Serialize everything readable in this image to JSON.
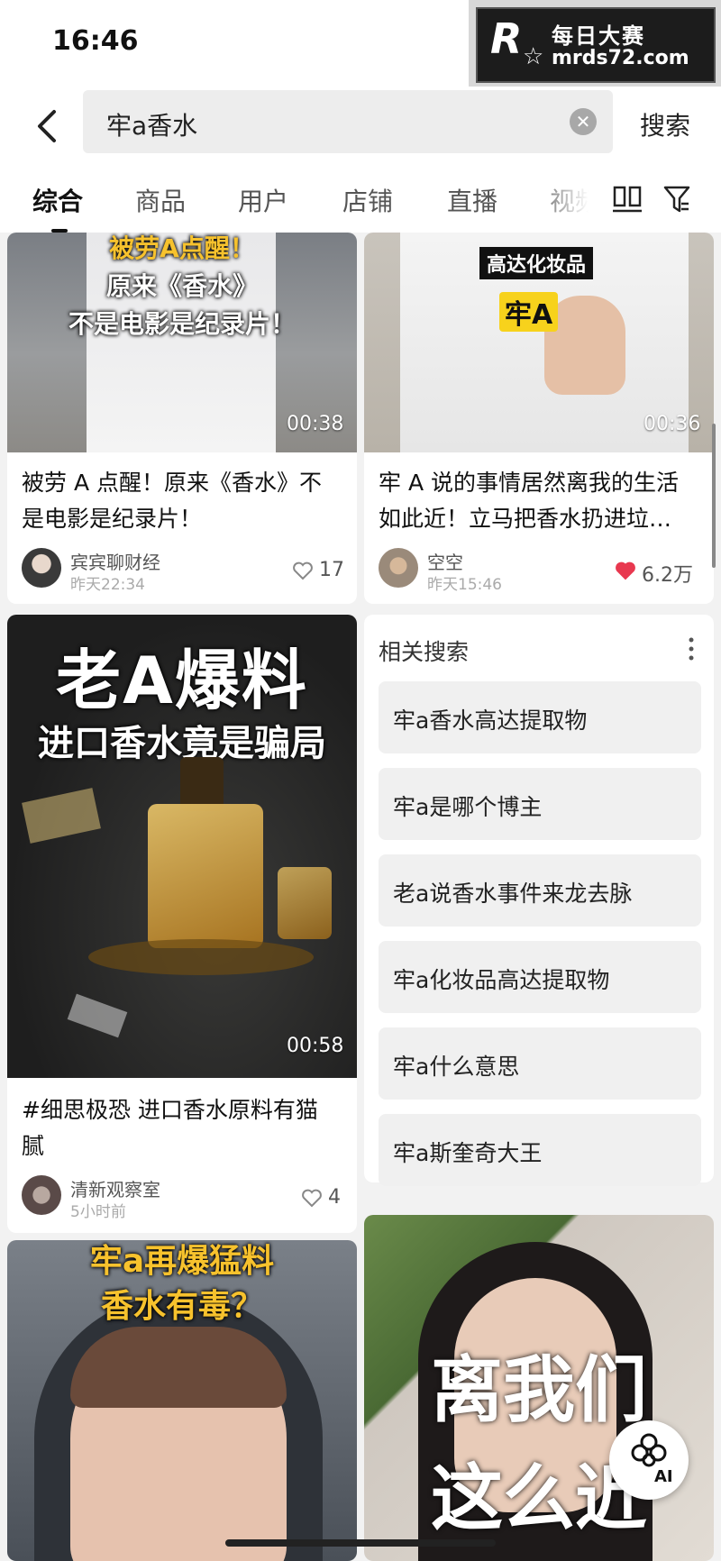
{
  "status_bar": {
    "time": "16:46"
  },
  "watermark": {
    "logo": "R",
    "cn": "每日大赛",
    "url": "mrds72.com"
  },
  "search": {
    "query": "牢a香水",
    "button_label": "搜索"
  },
  "tabs": [
    {
      "label": "综合",
      "active": true
    },
    {
      "label": "商品"
    },
    {
      "label": "用户"
    },
    {
      "label": "店铺"
    },
    {
      "label": "直播"
    },
    {
      "label": "视频"
    }
  ],
  "cards": [
    {
      "overlay_lines": [
        "被劳A点醒！",
        "原来《香水》",
        "不是电影是纪录片！"
      ],
      "duration": "00:38",
      "title_lines": [
        "被劳 A 点醒！原来《香水》不",
        "是电影是纪录片！"
      ],
      "author": "宾宾聊财经",
      "time": "昨天22:34",
      "likes": "17",
      "liked": false
    },
    {
      "overlay_label": "高达化妆品",
      "overlay_tag": "牢A",
      "duration": "00:36",
      "title_lines": [
        "牢 A 说的事情居然离我的生活",
        "如此近！立马把香水扔进垃…"
      ],
      "author": "空空",
      "time": "昨天15:46",
      "likes": "6.2万",
      "liked": true
    },
    {
      "overlay_lines": [
        "老A爆料",
        "进口香水竟是骗局"
      ],
      "duration": "00:58",
      "title_lines": [
        "#细思极恐 进口香水原料有猫",
        "腻"
      ],
      "author": "清新观察室",
      "time": "5小时前",
      "likes": "4",
      "liked": false
    },
    {
      "overlay_lines": [
        "牢a再爆猛料",
        "香水有毒？"
      ]
    },
    {
      "overlay_lines": [
        "离我们",
        "这么近"
      ]
    }
  ],
  "related": {
    "title": "相关搜索",
    "items": [
      "牢a香水高达提取物",
      "牢a是哪个博主",
      "老a说香水事件来龙去脉",
      "牢a化妆品高达提取物",
      "牢a什么意思",
      "牢a斯奎奇大王"
    ]
  },
  "ai_button": {
    "label": "AI"
  },
  "colors": {
    "liked_heart": "#e8384f",
    "accent": "#111111"
  }
}
